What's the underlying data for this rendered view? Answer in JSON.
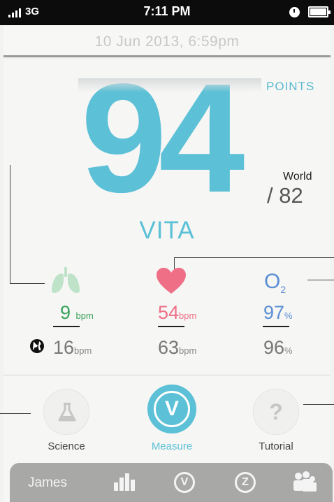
{
  "status_bar": {
    "network": "3G",
    "time": "7:11 PM"
  },
  "header": {
    "date": "10 Jun 2013, 6:59pm"
  },
  "score": {
    "points_label": "POINTS",
    "value": "94",
    "world_label": "World",
    "world_value": "/ 82",
    "name": "VITA"
  },
  "metrics": {
    "breathing": {
      "value": "9",
      "unit": "bpm",
      "world_value": "16",
      "world_unit": "bpm",
      "color": "#3aa35a"
    },
    "heart": {
      "value": "54",
      "unit": "bpm",
      "world_value": "63",
      "world_unit": "bpm",
      "color": "#ee6f86"
    },
    "oxygen": {
      "value": "97",
      "unit": "%",
      "world_value": "96",
      "world_unit": "%",
      "color": "#5a8ed3",
      "icon_text": "O",
      "icon_sub": "2"
    }
  },
  "actions": {
    "science": "Science",
    "measure": "Measure",
    "tutorial": "Tutorial",
    "tutorial_glyph": "?",
    "measure_glyph": "V"
  },
  "tabbar": {
    "user": "James",
    "v_glyph": "V",
    "z_glyph": "Z"
  },
  "colors": {
    "accent": "#5cc0d6",
    "lungs": "#bfe3c9",
    "heart": "#ee6f86",
    "oxygen": "#5a8ed3"
  },
  "icons": [
    "lungs-icon",
    "heart-icon",
    "oxygen-icon",
    "globe-icon",
    "flask-icon",
    "question-icon",
    "vita-icon",
    "chart-icon",
    "z-icon",
    "people-icon"
  ]
}
